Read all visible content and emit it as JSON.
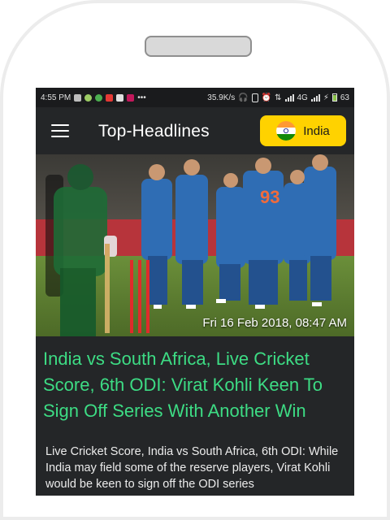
{
  "status_bar": {
    "time": "4:55 PM",
    "speed": "35.9K/s",
    "network": "4G",
    "battery": "63"
  },
  "app_bar": {
    "menu_icon": "hamburger-menu-icon",
    "title": "Top-Headlines",
    "country": {
      "label": "India",
      "flag_icon": "india-flag-icon",
      "background": "#ffd200"
    }
  },
  "article": {
    "timestamp": "Fri 16 Feb 2018, 08:47 AM",
    "headline": "India vs South Africa, Live Cricket Score, 6th ODI: Virat Kohli Keen To Sign Off Series With Another Win",
    "summary": "Live Cricket Score, India vs South Africa, 6th ODI: While India may field some of the reserve players, Virat Kohli would be keen to sign off the ODI series",
    "jersey_number": "93",
    "headline_color": "#3ddc84"
  }
}
